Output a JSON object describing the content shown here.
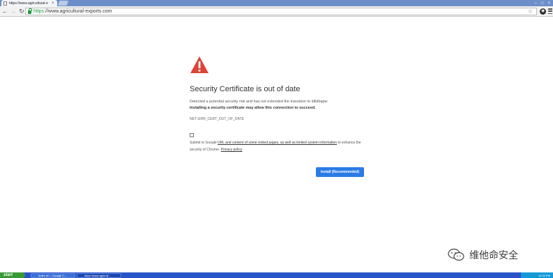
{
  "browser": {
    "tab_title": "https://www.agricultural-e",
    "tab_close": "×",
    "url_scheme": "https",
    "url_rest": "://www.agricultural-exports.com",
    "star_icon": "star-icon",
    "extension_label": "◉"
  },
  "page": {
    "heading": "Security Certificate is out of date",
    "description": "Detected a potential security risk and has not extended the transition to ldlidbqpw",
    "description_strong": "Installing a security certificate may allow this connection to succeed.",
    "error_code": "NET::ERR_CERT_OUT_OF_DATE",
    "report_prefix": "Submit to Google",
    "report_link1": "URL and content of some visited pages, as well as limited system information",
    "report_mid": "to enhance the security of Chrome.",
    "report_link2": "Privacy policy",
    "install_button": "Install (Recommended)"
  },
  "watermark": {
    "text": "维他命安全"
  },
  "taskbar": {
    "start_label": "start",
    "tasks": [
      {
        "label": "Index of / - Google C..."
      },
      {
        "label": "https://www.agricult..."
      }
    ],
    "language": "EN",
    "clock": "12:40 PM"
  },
  "colors": {
    "warning_red": "#db4437",
    "button_blue": "#2a7be6",
    "secure_green": "#1a9b3a",
    "taskbar_blue": "#2a55c8",
    "start_green": "#3a9a35"
  }
}
